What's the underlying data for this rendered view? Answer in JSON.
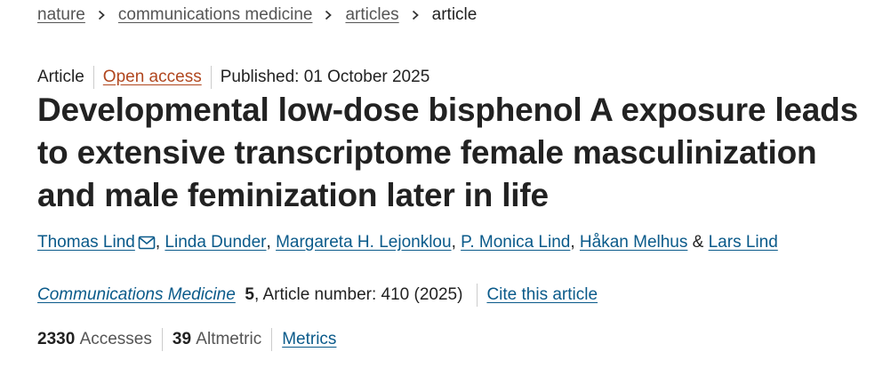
{
  "breadcrumb": {
    "items": [
      "nature",
      "communications medicine",
      "articles"
    ],
    "current": "article"
  },
  "meta": {
    "type": "Article",
    "access": "Open access",
    "published": "Published: 01 October 2025"
  },
  "title": "Developmental low-dose bisphenol A exposure leads to extensive transcriptome female masculinization and male feminization later in life",
  "authors": {
    "names": [
      "Thomas Lind",
      "Linda Dunder",
      "Margareta H. Lejonklou",
      "P. Monica Lind",
      "Håkan Melhus",
      "Lars Lind"
    ],
    "separator": ", ",
    "last_separator": " & ",
    "corresponding_icon": "mail-icon"
  },
  "citation": {
    "journal": "Communications Medicine",
    "volume": "5",
    "article_number": ", Article number: 410 (2025)",
    "cite_label": "Cite this article"
  },
  "metrics": {
    "accesses_count": "2330",
    "accesses_label": "Accesses",
    "altmetric_count": "39",
    "altmetric_label": "Altmetric",
    "metrics_link": "Metrics"
  },
  "colors": {
    "link": "#0a5a8a",
    "open_access": "#b1471f",
    "text": "#222222",
    "muted": "#555555",
    "divider": "#cccccc"
  }
}
